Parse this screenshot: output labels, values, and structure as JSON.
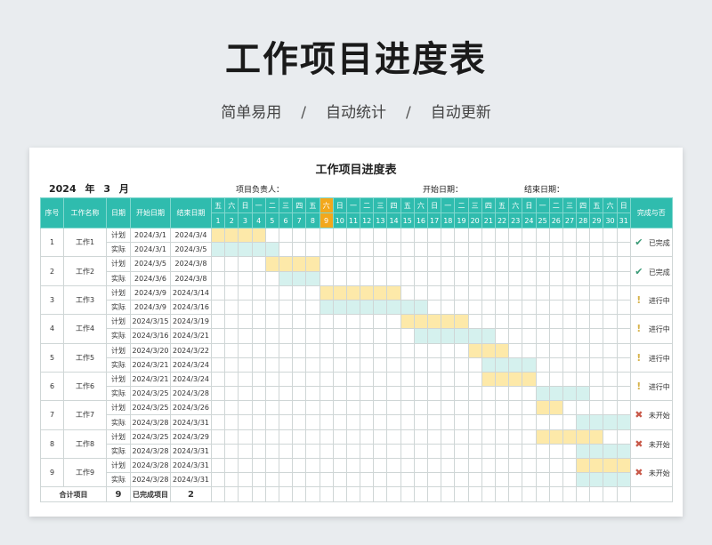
{
  "header": {
    "title": "工作项目进度表",
    "subtitle": [
      "简单易用",
      "自动统计",
      "自动更新"
    ],
    "separator": "/"
  },
  "sheet": {
    "title": "工作项目进度表",
    "year": "2024",
    "year_unit": "年",
    "month": "3",
    "month_unit": "月",
    "manager_label": "项目负责人：",
    "start_label": "开始日期：",
    "end_label": "结束日期：",
    "columns": {
      "seq": "序号",
      "name": "工作名称",
      "date": "日期",
      "start": "开始日期",
      "end": "结束日期",
      "status": "完成与否"
    },
    "weekdays": [
      "五",
      "六",
      "日",
      "一",
      "二",
      "三",
      "四",
      "五",
      "六",
      "日",
      "一",
      "二",
      "三",
      "四",
      "五",
      "六",
      "日",
      "一",
      "二",
      "三",
      "四",
      "五",
      "六",
      "日",
      "一",
      "二",
      "三",
      "四",
      "五",
      "六",
      "日"
    ],
    "days": [
      "1",
      "2",
      "3",
      "4",
      "5",
      "6",
      "7",
      "8",
      "9",
      "10",
      "11",
      "12",
      "13",
      "14",
      "15",
      "16",
      "17",
      "18",
      "19",
      "20",
      "21",
      "22",
      "23",
      "24",
      "25",
      "26",
      "27",
      "28",
      "29",
      "30",
      "31"
    ],
    "highlight_day": 9,
    "plan_label": "计划",
    "actual_label": "实际",
    "colors": {
      "header": "#2fbcae",
      "today": "#f2a81d",
      "plan": "#fde9a9",
      "actual": "#d5f1ee"
    },
    "tasks": [
      {
        "seq": "1",
        "name": "工作1",
        "plan_start": "2024/3/1",
        "plan_end": "2024/3/4",
        "act_start": "2024/3/1",
        "act_end": "2024/3/5",
        "plan_span": [
          1,
          4
        ],
        "act_span": [
          1,
          5
        ],
        "status": "已完成",
        "status_icon": "check-icon"
      },
      {
        "seq": "2",
        "name": "工作2",
        "plan_start": "2024/3/5",
        "plan_end": "2024/3/8",
        "act_start": "2024/3/6",
        "act_end": "2024/3/8",
        "plan_span": [
          5,
          8
        ],
        "act_span": [
          6,
          8
        ],
        "status": "已完成",
        "status_icon": "check-icon"
      },
      {
        "seq": "3",
        "name": "工作3",
        "plan_start": "2024/3/9",
        "plan_end": "2024/3/14",
        "act_start": "2024/3/9",
        "act_end": "2024/3/16",
        "plan_span": [
          9,
          14
        ],
        "act_span": [
          9,
          16
        ],
        "status": "进行中",
        "status_icon": "exclamation-icon"
      },
      {
        "seq": "4",
        "name": "工作4",
        "plan_start": "2024/3/15",
        "plan_end": "2024/3/19",
        "act_start": "2024/3/16",
        "act_end": "2024/3/21",
        "plan_span": [
          15,
          19
        ],
        "act_span": [
          16,
          21
        ],
        "status": "进行中",
        "status_icon": "exclamation-icon"
      },
      {
        "seq": "5",
        "name": "工作5",
        "plan_start": "2024/3/20",
        "plan_end": "2024/3/22",
        "act_start": "2024/3/21",
        "act_end": "2024/3/24",
        "plan_span": [
          20,
          22
        ],
        "act_span": [
          21,
          24
        ],
        "status": "进行中",
        "status_icon": "exclamation-icon"
      },
      {
        "seq": "6",
        "name": "工作6",
        "plan_start": "2024/3/21",
        "plan_end": "2024/3/24",
        "act_start": "2024/3/25",
        "act_end": "2024/3/28",
        "plan_span": [
          21,
          24
        ],
        "act_span": [
          25,
          28
        ],
        "status": "进行中",
        "status_icon": "exclamation-icon"
      },
      {
        "seq": "7",
        "name": "工作7",
        "plan_start": "2024/3/25",
        "plan_end": "2024/3/26",
        "act_start": "2024/3/28",
        "act_end": "2024/3/31",
        "plan_span": [
          25,
          26
        ],
        "act_span": [
          28,
          31
        ],
        "status": "未开始",
        "status_icon": "cross-icon"
      },
      {
        "seq": "8",
        "name": "工作8",
        "plan_start": "2024/3/25",
        "plan_end": "2024/3/29",
        "act_start": "2024/3/28",
        "act_end": "2024/3/31",
        "plan_span": [
          25,
          29
        ],
        "act_span": [
          28,
          31
        ],
        "status": "未开始",
        "status_icon": "cross-icon"
      },
      {
        "seq": "9",
        "name": "工作9",
        "plan_start": "2024/3/28",
        "plan_end": "2024/3/31",
        "act_start": "2024/3/28",
        "act_end": "2024/3/31",
        "plan_span": [
          28,
          31
        ],
        "act_span": [
          28,
          31
        ],
        "status": "未开始",
        "status_icon": "cross-icon"
      }
    ],
    "footer": {
      "total_label": "合计项目",
      "total_value": "9",
      "done_label": "已完成项目",
      "done_value": "2"
    }
  }
}
